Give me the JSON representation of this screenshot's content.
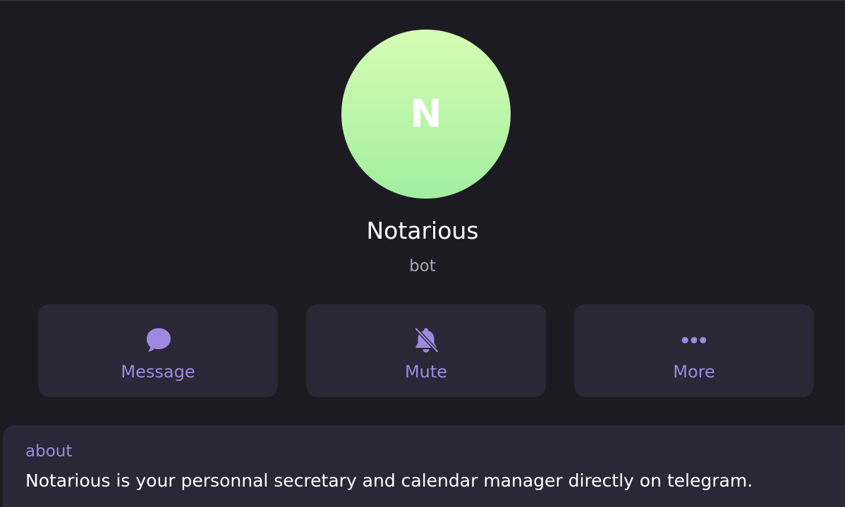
{
  "colors": {
    "background": "#1c1b22",
    "card": "#2a2737",
    "accent": "#9d8ae0",
    "text_primary": "#ffffff",
    "text_secondary": "#a8a5b8",
    "avatar_gradient_top": "#d6fcb4",
    "avatar_gradient_bottom": "#a2eea0"
  },
  "profile": {
    "avatar_letter": "N",
    "name": "Notarious",
    "status": "bot"
  },
  "actions": [
    {
      "label": "Message",
      "icon": "chat-bubble-icon"
    },
    {
      "label": "Mute",
      "icon": "bell-slash-icon"
    },
    {
      "label": "More",
      "icon": "ellipsis-icon"
    }
  ],
  "about": {
    "label": "about",
    "text": "Notarious is your personnal secretary and calendar manager directly on telegram."
  }
}
